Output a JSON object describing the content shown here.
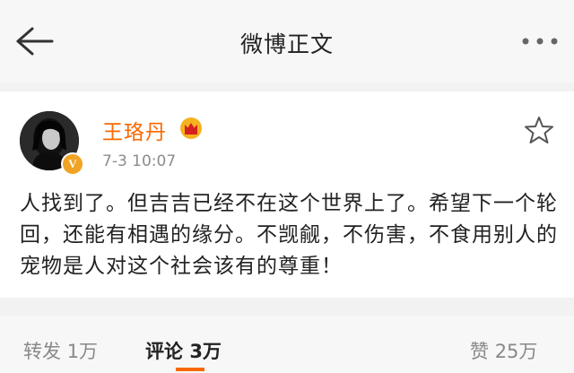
{
  "header": {
    "title": "微博正文"
  },
  "post": {
    "username": "王珞丹",
    "verified_badge": "V",
    "time": "7-3 10:07",
    "content": "人找到了。但吉吉已经不在这个世界上了。希望下一个轮回，还能有相遇的缘分。不觊觎，不伤害，不食用别人的宠物是人对这个社会该有的尊重！"
  },
  "actions": {
    "repost_label": "转发",
    "repost_count": "1万",
    "comment_label": "评论",
    "comment_count": "3万",
    "like_label": "赞",
    "like_count": "25万"
  },
  "colors": {
    "accent": "#f86800",
    "verified": "#f1a325"
  },
  "icons": {
    "back": "back-arrow-icon",
    "more": "more-dots-icon",
    "crown": "crown-icon",
    "favorite": "star-icon"
  }
}
